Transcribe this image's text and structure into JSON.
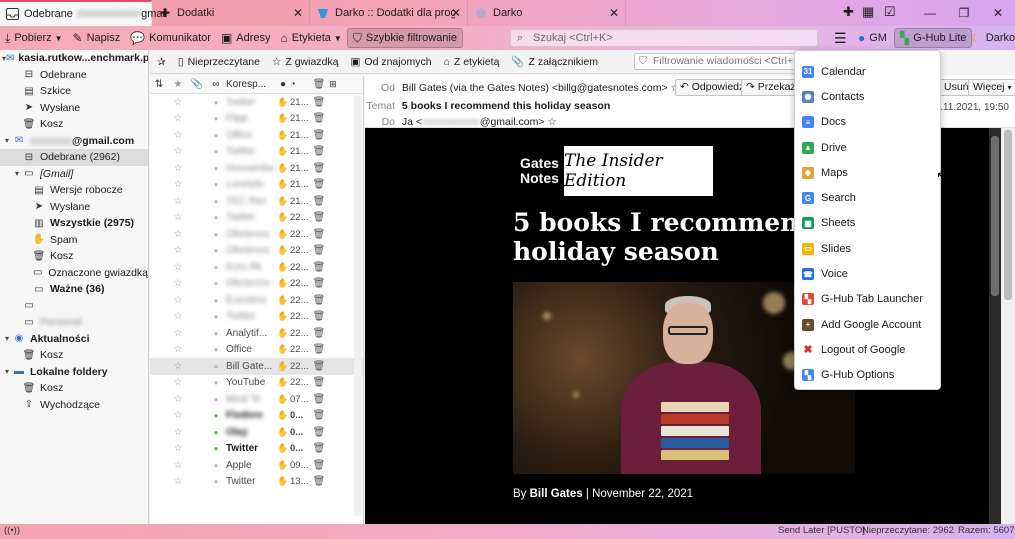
{
  "tabs": [
    {
      "label": "Odebrane",
      "suffix": "gmail",
      "icon": "inbox-icon",
      "active": true
    },
    {
      "label": "Dodatki",
      "icon": "puzzle-icon",
      "active": false
    },
    {
      "label": "Darko :: Dodatki dla progra",
      "icon": "theme-icon",
      "active": false
    },
    {
      "label": "Darko",
      "icon": "theme-icon",
      "active": false
    }
  ],
  "toolbar": {
    "get": "Pobierz",
    "write": "Napisz",
    "chat": "Komunikator",
    "addresses": "Adresy",
    "tag": "Etykieta",
    "quick_filter": "Szybkie filtrowanie",
    "search_placeholder": "Szukaj <Ctrl+K>",
    "gm": "GM",
    "ghub": "G-Hub Lite",
    "theme": "Darko"
  },
  "folders": [
    {
      "label": "kasia.rutkow...enchmark.pl",
      "level": 0,
      "expand": "▾",
      "icon": "account-icon",
      "bold": true
    },
    {
      "label": "Odebrane",
      "level": 1,
      "icon": "inbox-icon"
    },
    {
      "label": "Szkice",
      "level": 1,
      "icon": "drafts-icon"
    },
    {
      "label": "Wysłane",
      "level": 1,
      "icon": "sent-icon"
    },
    {
      "label": "Kosz",
      "level": 1,
      "icon": "trash-icon"
    },
    {
      "label": "@gmail.com",
      "level": 0,
      "expand": "▾",
      "icon": "account-icon",
      "bold": true,
      "blurred_prefix": true
    },
    {
      "label": "Odebrane (2962)",
      "level": 1,
      "icon": "inbox-icon",
      "selected": true
    },
    {
      "label": "[Gmail]",
      "level": 1,
      "expand": "▾",
      "icon": "folder-icon",
      "italic": true
    },
    {
      "label": "Wersje robocze",
      "level": 2,
      "icon": "drafts-icon"
    },
    {
      "label": "Wysłane",
      "level": 2,
      "icon": "sent-icon"
    },
    {
      "label": "Wszystkie (2975)",
      "level": 2,
      "icon": "archive-icon",
      "bold": true
    },
    {
      "label": "Spam",
      "level": 2,
      "icon": "spam-icon"
    },
    {
      "label": "Kosz",
      "level": 2,
      "icon": "trash-icon"
    },
    {
      "label": "Oznaczone gwiazdką",
      "level": 2,
      "icon": "folder-icon"
    },
    {
      "label": "Ważne (36)",
      "level": 2,
      "icon": "folder-icon",
      "bold": true
    },
    {
      "label": "",
      "level": 1,
      "icon": "folder-icon",
      "blurred": true
    },
    {
      "label": "Personal",
      "level": 1,
      "icon": "folder-icon",
      "blurred": true
    },
    {
      "label": "Aktualności",
      "level": 0,
      "expand": "▾",
      "icon": "rss-icon",
      "bold": true
    },
    {
      "label": "Kosz",
      "level": 1,
      "icon": "trash-icon"
    },
    {
      "label": "Lokalne foldery",
      "level": 0,
      "expand": "▾",
      "icon": "local-folder-icon",
      "bold": true
    },
    {
      "label": "Kosz",
      "level": 1,
      "icon": "trash-icon"
    },
    {
      "label": "Wychodzące",
      "level": 1,
      "icon": "outbox-icon"
    }
  ],
  "filterbar": {
    "unread": "Nieprzeczytane",
    "starred": "Z gwiazdką",
    "contacts": "Od znajomych",
    "tagged": "Z etykietą",
    "attachment": "Z załącznikiem",
    "search_placeholder": "Filtrowanie wiadomości <Ctrl+Shift+"
  },
  "message_list": {
    "headers": {
      "correspondent": "Koresp..."
    },
    "rows": [
      {
        "corr": "Twitter",
        "date": "21...",
        "blur": true,
        "junk": "hand"
      },
      {
        "corr": "Flipp",
        "date": "21...",
        "blur": true,
        "junk": "hand"
      },
      {
        "corr": "Office",
        "date": "21...",
        "blur": true,
        "junk": "hand"
      },
      {
        "corr": "Twitter",
        "date": "21...",
        "blur": true,
        "junk": "hand"
      },
      {
        "corr": "Hussainba",
        "date": "21...",
        "blur": true,
        "junk": "hand"
      },
      {
        "corr": "Lonelyfu",
        "date": "21...",
        "blur": true,
        "junk": "hand"
      },
      {
        "corr": "TEC Rec",
        "date": "21...",
        "blur": true,
        "junk": "hand"
      },
      {
        "corr": "Twitter",
        "date": "22...",
        "blur": true,
        "junk": "hand"
      },
      {
        "corr": "Ofertenov",
        "date": "22...",
        "blur": true,
        "junk": "hand"
      },
      {
        "corr": "Ofertenov",
        "date": "22...",
        "blur": true,
        "junk": "hand"
      },
      {
        "corr": "Kurs Rk",
        "date": "22...",
        "blur": true,
        "junk": "hand"
      },
      {
        "corr": "Ofertenov",
        "date": "22...",
        "blur": true,
        "junk": "hand"
      },
      {
        "corr": "Eventimc",
        "date": "22...",
        "blur": true,
        "junk": "flame"
      },
      {
        "corr": "Twitter",
        "date": "22...",
        "blur": true,
        "junk": "flame"
      },
      {
        "corr": "Analytif...",
        "date": "22...",
        "blur": false,
        "junk": "hand"
      },
      {
        "corr": "Office",
        "date": "22...",
        "blur": false,
        "junk": "hand"
      },
      {
        "corr": "Bill Gate...",
        "date": "22...",
        "blur": false,
        "junk": "hand",
        "selected": true
      },
      {
        "corr": "YouTube",
        "date": "22...",
        "blur": false,
        "junk": "hand"
      },
      {
        "corr": "Mind Te",
        "date": "07...",
        "blur": true,
        "junk": "hand"
      },
      {
        "corr": "Fiodore",
        "date": "0...",
        "blur": true,
        "junk": "hand",
        "green": true,
        "bold": true
      },
      {
        "corr": "Olay",
        "date": "0...",
        "blur": true,
        "junk": "hand",
        "green": true,
        "bold": true
      },
      {
        "corr": "Twitter",
        "date": "0...",
        "blur": false,
        "junk": "hand",
        "green": true,
        "bold": true
      },
      {
        "corr": "Apple",
        "date": "09...",
        "blur": false,
        "junk": "flame"
      },
      {
        "corr": "Twitter",
        "date": "13...",
        "blur": false,
        "junk": "flame"
      }
    ]
  },
  "header": {
    "from_label": "Od",
    "from": "Bill Gates (via the Gates Notes) <billg@gatesnotes.com>",
    "subject_label": "Temat",
    "subject": "5 books I recommend this holiday season",
    "to_label": "Do",
    "to": "Ja <",
    "to_suffix": "@gmail.com>",
    "reply": "Odpowiedz",
    "forward": "Przekaż",
    "delete": "Usuń",
    "more": "Więcej",
    "date": "22.11.2021, 19:50"
  },
  "email": {
    "logo_line1": "Gates",
    "logo_line2": "Notes",
    "insider": "The Insider Edition",
    "headline": "5 books I recommend this holiday season",
    "byline_prefix": "By ",
    "byline_author": "Bill Gates",
    "byline_date": " | November 22, 2021"
  },
  "dropdown": {
    "items": [
      {
        "label": "Calendar",
        "icon": "calendar-icon",
        "color": "#4285f4",
        "glyph": "31"
      },
      {
        "label": "Contacts",
        "icon": "contacts-icon",
        "color": "#5a7fbf",
        "glyph": "◉"
      },
      {
        "label": "Docs",
        "icon": "docs-icon",
        "color": "#4285f4",
        "glyph": "≡"
      },
      {
        "label": "Drive",
        "icon": "drive-icon",
        "color": "#34a853",
        "glyph": "▲"
      },
      {
        "label": "Maps",
        "icon": "maps-icon",
        "color": "#e8a23c",
        "glyph": "◆"
      },
      {
        "label": "Search",
        "icon": "search-icon",
        "color": "#4285f4",
        "glyph": "G"
      },
      {
        "label": "Sheets",
        "icon": "sheets-icon",
        "color": "#0f9d58",
        "glyph": "▦"
      },
      {
        "label": "Slides",
        "icon": "slides-icon",
        "color": "#f4b400",
        "glyph": "▭"
      },
      {
        "label": "Voice",
        "icon": "voice-icon",
        "color": "#1a73e8",
        "glyph": "☎"
      },
      {
        "label": "G-Hub Tab Launcher",
        "icon": "ghub-icon",
        "color": "#e04c2f",
        "glyph": "▚"
      },
      {
        "label": "Add Google Account",
        "icon": "add-account-icon",
        "color": "#6a4a2a",
        "glyph": "+"
      },
      {
        "label": "Logout of Google",
        "icon": "logout-icon",
        "color": "#d93025",
        "glyph": "✖"
      },
      {
        "label": "G-Hub Options",
        "icon": "ghub-options-icon",
        "color": "#4285f4",
        "glyph": "▚"
      }
    ]
  },
  "status": {
    "send_later": "Send Later [PUSTO]",
    "unread": "Nieprzeczytane: 2962",
    "total": "Razem: 5607"
  }
}
